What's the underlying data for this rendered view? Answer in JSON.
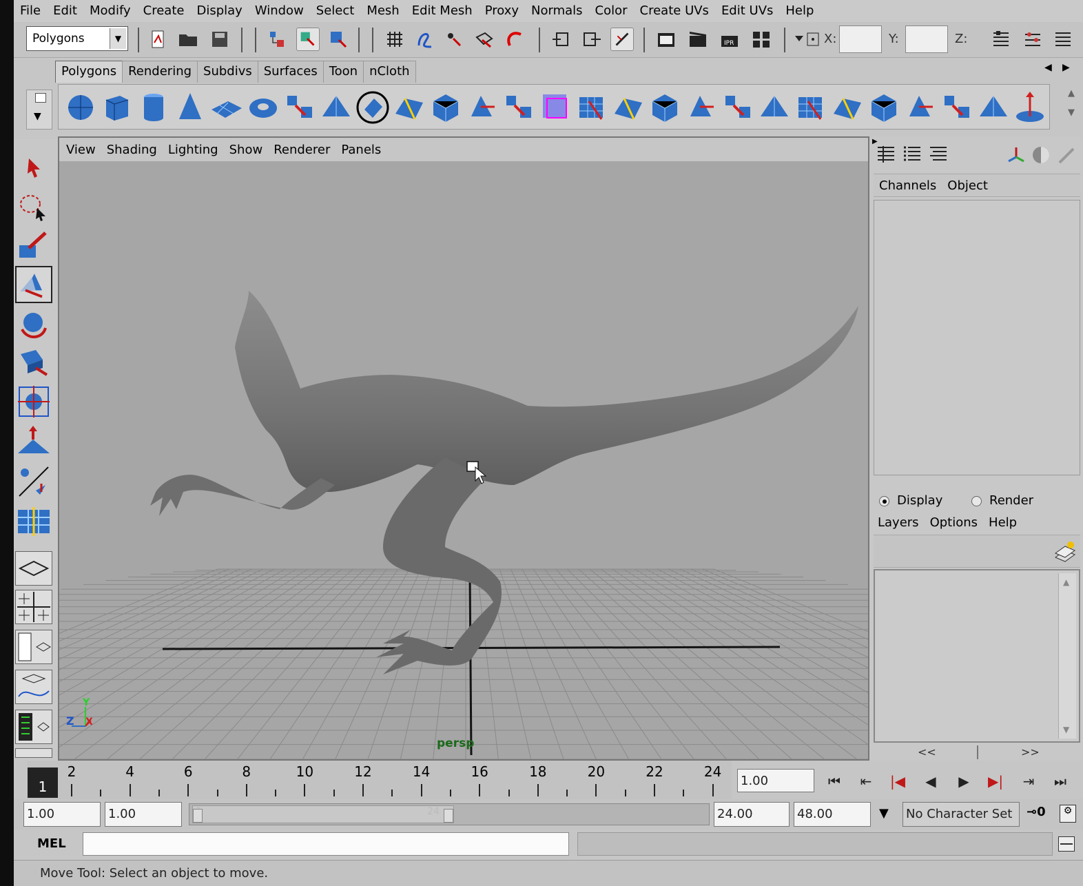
{
  "menubar": [
    "File",
    "Edit",
    "Modify",
    "Create",
    "Display",
    "Window",
    "Select",
    "Mesh",
    "Edit Mesh",
    "Proxy",
    "Normals",
    "Color",
    "Create UVs",
    "Edit UVs",
    "Help"
  ],
  "status_line": {
    "mode": "Polygons",
    "coord_labels": {
      "x": "X:",
      "y": "Y:",
      "z": "Z:"
    }
  },
  "shelf": {
    "tabs": [
      "Polygons",
      "Rendering",
      "Subdivs",
      "Surfaces",
      "Toon",
      "nCloth"
    ],
    "active_tab": "Polygons",
    "icons": [
      "poly-sphere-icon",
      "poly-cube-icon",
      "poly-cylinder-icon",
      "poly-cone-icon",
      "poly-plane-icon",
      "poly-torus-icon",
      "poly-prism-icon",
      "poly-pipe-icon",
      "poly-helix-icon",
      "combine-icon",
      "separate-icon",
      "extract-icon",
      "smooth-proxy-icon",
      "subdiv-proxy-icon",
      "append-polygon-icon",
      "split-polygon-icon",
      "extrude-face-icon",
      "extrude-edge-icon",
      "bridge-icon",
      "bevel-icon",
      "merge-icon",
      "insert-edge-loop-icon",
      "offset-edge-loop-icon",
      "triangulate-icon",
      "quadrangulate-icon",
      "cut-faces-icon",
      "soft-mod-icon"
    ]
  },
  "toolbox": {
    "tools": [
      "select-tool-icon",
      "lasso-tool-icon",
      "paint-select-tool-icon",
      "move-tool-icon",
      "rotate-tool-icon",
      "scale-tool-icon",
      "universal-manipulator-icon",
      "soft-modification-icon",
      "show-manipulator-icon",
      "last-tool-icon"
    ],
    "selected": "move-tool-icon"
  },
  "viewport": {
    "menu": [
      "View",
      "Shading",
      "Lighting",
      "Show",
      "Renderer",
      "Panels"
    ],
    "camera_label": "persp",
    "axis": {
      "y": "Y",
      "z": "Z",
      "x": "X"
    }
  },
  "channel_box": {
    "menu": [
      "Channels",
      "Object"
    ]
  },
  "layer_editor": {
    "modes": [
      "Display",
      "Render"
    ],
    "selected_mode": "Display",
    "menu": [
      "Layers",
      "Options",
      "Help"
    ],
    "nav": {
      "prev": "<<",
      "next": ">>"
    }
  },
  "time_slider": {
    "current_frame": "1",
    "tick_labels": [
      "2",
      "4",
      "6",
      "8",
      "10",
      "12",
      "14",
      "16",
      "18",
      "20",
      "22",
      "24"
    ],
    "current_time_field": "1.00"
  },
  "range_slider": {
    "start_time": "1.00",
    "playback_start": "1.00",
    "handle_start": "1",
    "handle_end": "24",
    "playback_end": "24.00",
    "end_time": "48.00",
    "character_set": "No Character Set"
  },
  "command_line": {
    "label": "MEL",
    "value": ""
  },
  "help_line": "Move Tool: Select an object to move.",
  "colors": {
    "ui_bg": "#c8c8c8",
    "viewport_bg": "#a6a6a6",
    "icon_blue": "#2f6fc4",
    "model_gray": "#777777"
  }
}
